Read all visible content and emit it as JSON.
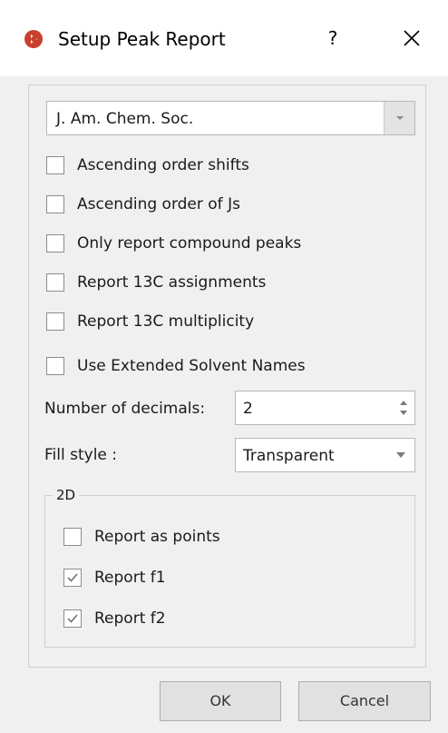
{
  "window": {
    "title": "Setup Peak Report",
    "help_label": "?",
    "close_icon": "close-icon",
    "app_icon": "app-logo-icon"
  },
  "journal": {
    "selected": "J. Am. Chem. Soc."
  },
  "options": [
    {
      "label": "Ascending order shifts",
      "checked": false
    },
    {
      "label": "Ascending order of Js",
      "checked": false
    },
    {
      "label": "Only report compound peaks",
      "checked": false
    },
    {
      "label": "Report 13C assignments",
      "checked": false
    },
    {
      "label": "Report 13C multiplicity",
      "checked": false
    },
    {
      "label": "Use Extended Solvent Names",
      "checked": false
    }
  ],
  "decimals": {
    "label": "Number of decimals:",
    "value": "2"
  },
  "fill_style": {
    "label": "Fill style :",
    "selected": "Transparent"
  },
  "group_2d": {
    "title": "2D",
    "options": [
      {
        "label": "Report as points",
        "checked": false
      },
      {
        "label": "Report f1",
        "checked": true
      },
      {
        "label": "Report f2",
        "checked": true
      }
    ]
  },
  "buttons": {
    "ok": "OK",
    "cancel": "Cancel"
  },
  "colors": {
    "app_icon": "#c8402c",
    "checkmark": "#6b6b6b"
  }
}
